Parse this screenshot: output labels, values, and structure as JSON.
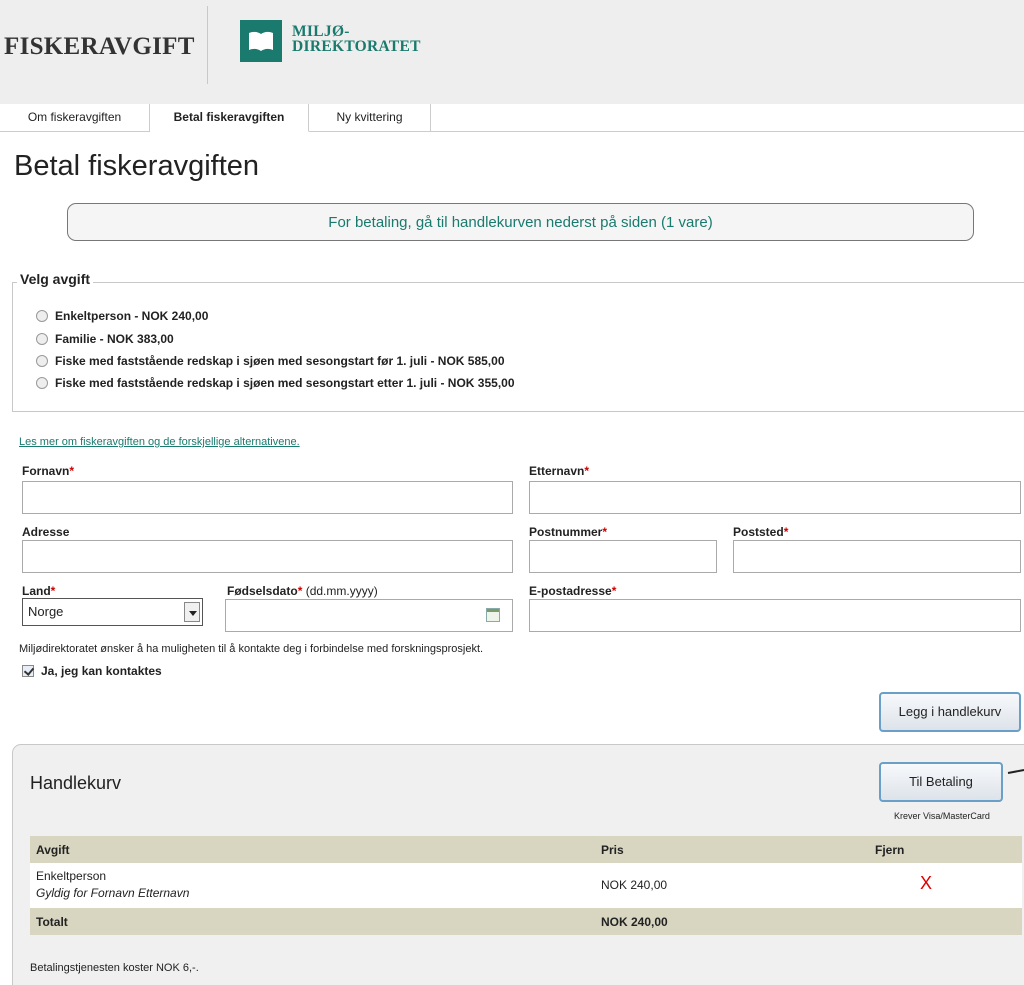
{
  "header": {
    "brand": "FISKERAVGIFT",
    "logo_line1": "MILJØ-",
    "logo_line2": "DIREKTORATET",
    "colors": {
      "brand_teal": "#1a7a6e",
      "header_bg": "#eeeeee"
    }
  },
  "tabs": [
    {
      "label": "Om fiskeravgiften"
    },
    {
      "label": "Betal fiskeravgiften",
      "active": true
    },
    {
      "label": "Ny kvittering"
    }
  ],
  "page_title": "Betal fiskeravgiften",
  "notice": "For betaling, gå til handlekurven nederst på siden (1 vare)",
  "fee_selection": {
    "legend": "Velg avgift",
    "options": [
      {
        "label": "Enkeltperson - NOK 240,00",
        "selected": false
      },
      {
        "label": "Familie - NOK 383,00",
        "selected": false
      },
      {
        "label": "Fiske med faststående redskap i sjøen med sesongstart før 1. juli - NOK 585,00",
        "selected": false
      },
      {
        "label": "Fiske med faststående redskap i sjøen med sesongstart etter 1. juli - NOK 355,00",
        "selected": false
      }
    ]
  },
  "info_link": "Les mer om fiskeravgiften og de forskjellige alternativene.",
  "form": {
    "required_marker": "*",
    "fornavn": {
      "label": "Fornavn",
      "value": ""
    },
    "etternavn": {
      "label": "Etternavn",
      "value": ""
    },
    "adresse": {
      "label": "Adresse",
      "value": ""
    },
    "postnummer": {
      "label": "Postnummer",
      "value": ""
    },
    "poststed": {
      "label": "Poststed",
      "value": ""
    },
    "land": {
      "label": "Land",
      "value": "Norge"
    },
    "fodselsdato": {
      "label": "Fødselsdato",
      "hint": " (dd.mm.yyyy)",
      "value": ""
    },
    "epost": {
      "label": "E-postadresse",
      "value": ""
    }
  },
  "consent": {
    "text": "Miljødirektoratet ønsker å ha muligheten til å kontakte deg i forbindelse med forskningsprosjekt.",
    "checkbox_label": "Ja, jeg kan kontaktes",
    "checked": true
  },
  "add_to_cart_label": "Legg i handlekurv",
  "cart": {
    "title": "Handlekurv",
    "checkout_label": "Til Betaling",
    "checkout_note": "Krever Visa/MasterCard",
    "columns": [
      "Avgift",
      "Pris",
      "Fjern"
    ],
    "items": [
      {
        "name": "Enkeltperson",
        "subtitle": "Gyldig for Fornavn Etternavn",
        "price": "NOK 240,00",
        "remove": "X"
      }
    ],
    "total_label": "Totalt",
    "total_value": "NOK 240,00",
    "fee_note": "Betalingstjenesten koster NOK 6,-."
  }
}
